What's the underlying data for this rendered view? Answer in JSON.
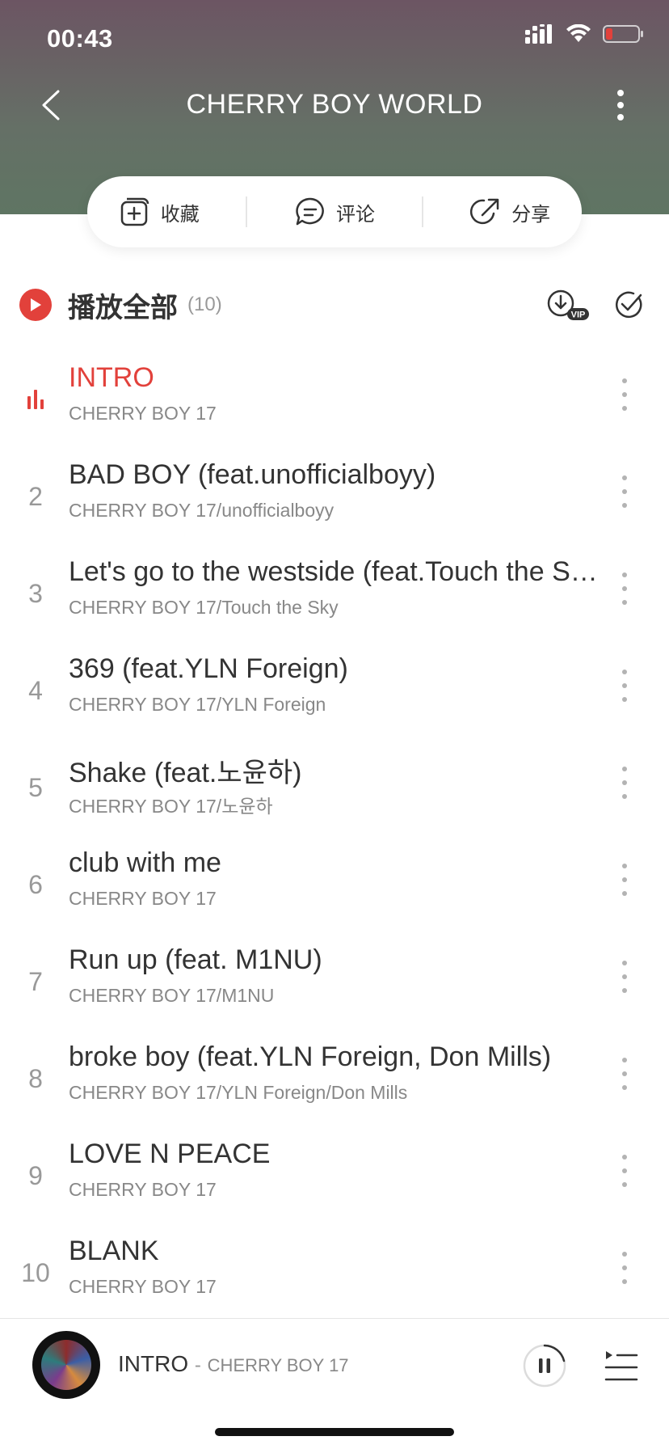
{
  "status": {
    "time": "00:43"
  },
  "nav": {
    "title": "CHERRY BOY WORLD"
  },
  "actions": [
    {
      "label": "收藏",
      "icon": "collect-icon"
    },
    {
      "label": "评论",
      "icon": "comment-icon"
    },
    {
      "label": "分享",
      "icon": "share-icon"
    }
  ],
  "play_all": {
    "label": "播放全部",
    "count": "(10)"
  },
  "tracks": [
    {
      "index": "",
      "title": "INTRO",
      "artist": "CHERRY BOY 17",
      "active": true
    },
    {
      "index": "2",
      "title": "BAD BOY (feat.unofficialboyy)",
      "artist": "CHERRY BOY 17/unofficialboyy"
    },
    {
      "index": "3",
      "title": "Let's go to the westside (feat.Touch the Sky)",
      "artist": "CHERRY BOY 17/Touch the Sky"
    },
    {
      "index": "4",
      "title": "369 (feat.YLN Foreign)",
      "artist": "CHERRY BOY 17/YLN Foreign"
    },
    {
      "index": "5",
      "title": "Shake (feat.노윤하)",
      "artist": "CHERRY BOY 17/노윤하"
    },
    {
      "index": "6",
      "title": "club with me",
      "artist": "CHERRY BOY 17"
    },
    {
      "index": "7",
      "title": "Run up (feat. M1NU)",
      "artist": "CHERRY BOY 17/M1NU"
    },
    {
      "index": "8",
      "title": "broke boy (feat.YLN Foreign, Don Mills)",
      "artist": "CHERRY BOY 17/YLN Foreign/Don Mills"
    },
    {
      "index": "9",
      "title": "LOVE N PEACE",
      "artist": "CHERRY BOY 17"
    },
    {
      "index": "10",
      "title": "BLANK",
      "artist": "CHERRY BOY 17"
    }
  ],
  "mini_player": {
    "title": "INTRO",
    "separator": "-",
    "artist": "CHERRY BOY 17"
  },
  "colors": {
    "accent": "#e2413b",
    "header_top": "#6c5563",
    "header_bottom": "#5f7563"
  }
}
